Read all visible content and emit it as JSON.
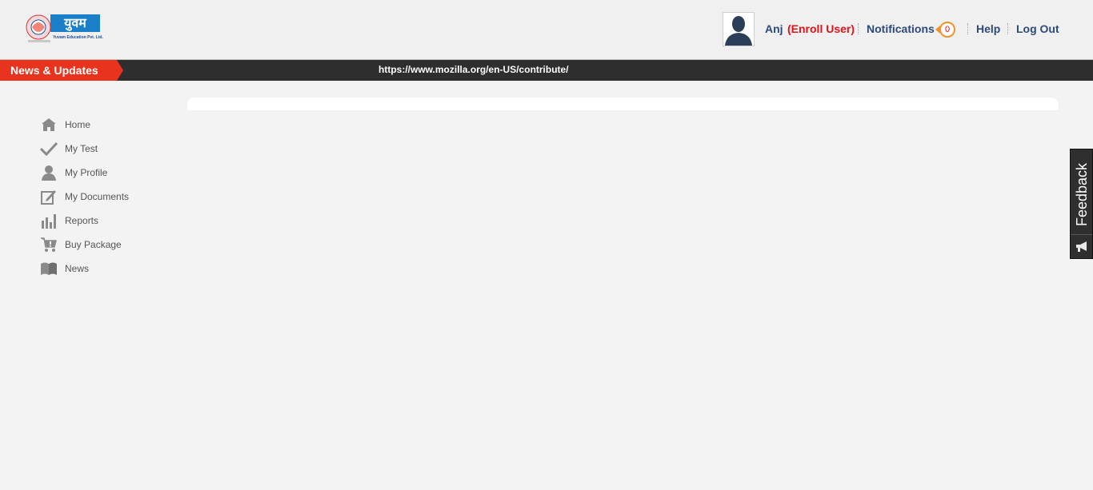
{
  "header": {
    "logo": {
      "name": "युवम",
      "subtitle": "Yuvam Education Pvt. Ltd."
    },
    "user": {
      "name": "Anj",
      "role": "(Enroll User)"
    },
    "notifications": {
      "label": "Notifications",
      "count": "0"
    },
    "help_label": "Help",
    "logout_label": "Log Out"
  },
  "newsbar": {
    "label": "News & Updates",
    "ticker": "https://www.mozilla.org/en-US/contribute/"
  },
  "sidebar": {
    "items": [
      {
        "label": "Home",
        "icon": "home-icon"
      },
      {
        "label": "My Test",
        "icon": "checkmark-icon"
      },
      {
        "label": "My Profile",
        "icon": "user-icon"
      },
      {
        "label": "My Documents",
        "icon": "edit-document-icon"
      },
      {
        "label": "Reports",
        "icon": "bar-chart-icon"
      },
      {
        "label": "Buy Package",
        "icon": "cart-icon"
      },
      {
        "label": "News",
        "icon": "book-icon"
      }
    ]
  },
  "feedback": {
    "label": "Feedback",
    "icon": "megaphone-icon"
  },
  "colors": {
    "accent_red": "#e8331e",
    "nav_blue": "#2c4a7a",
    "role_red": "#e0121a",
    "badge_orange": "#f0942a",
    "newsbar_dark": "#2e2e2e"
  }
}
